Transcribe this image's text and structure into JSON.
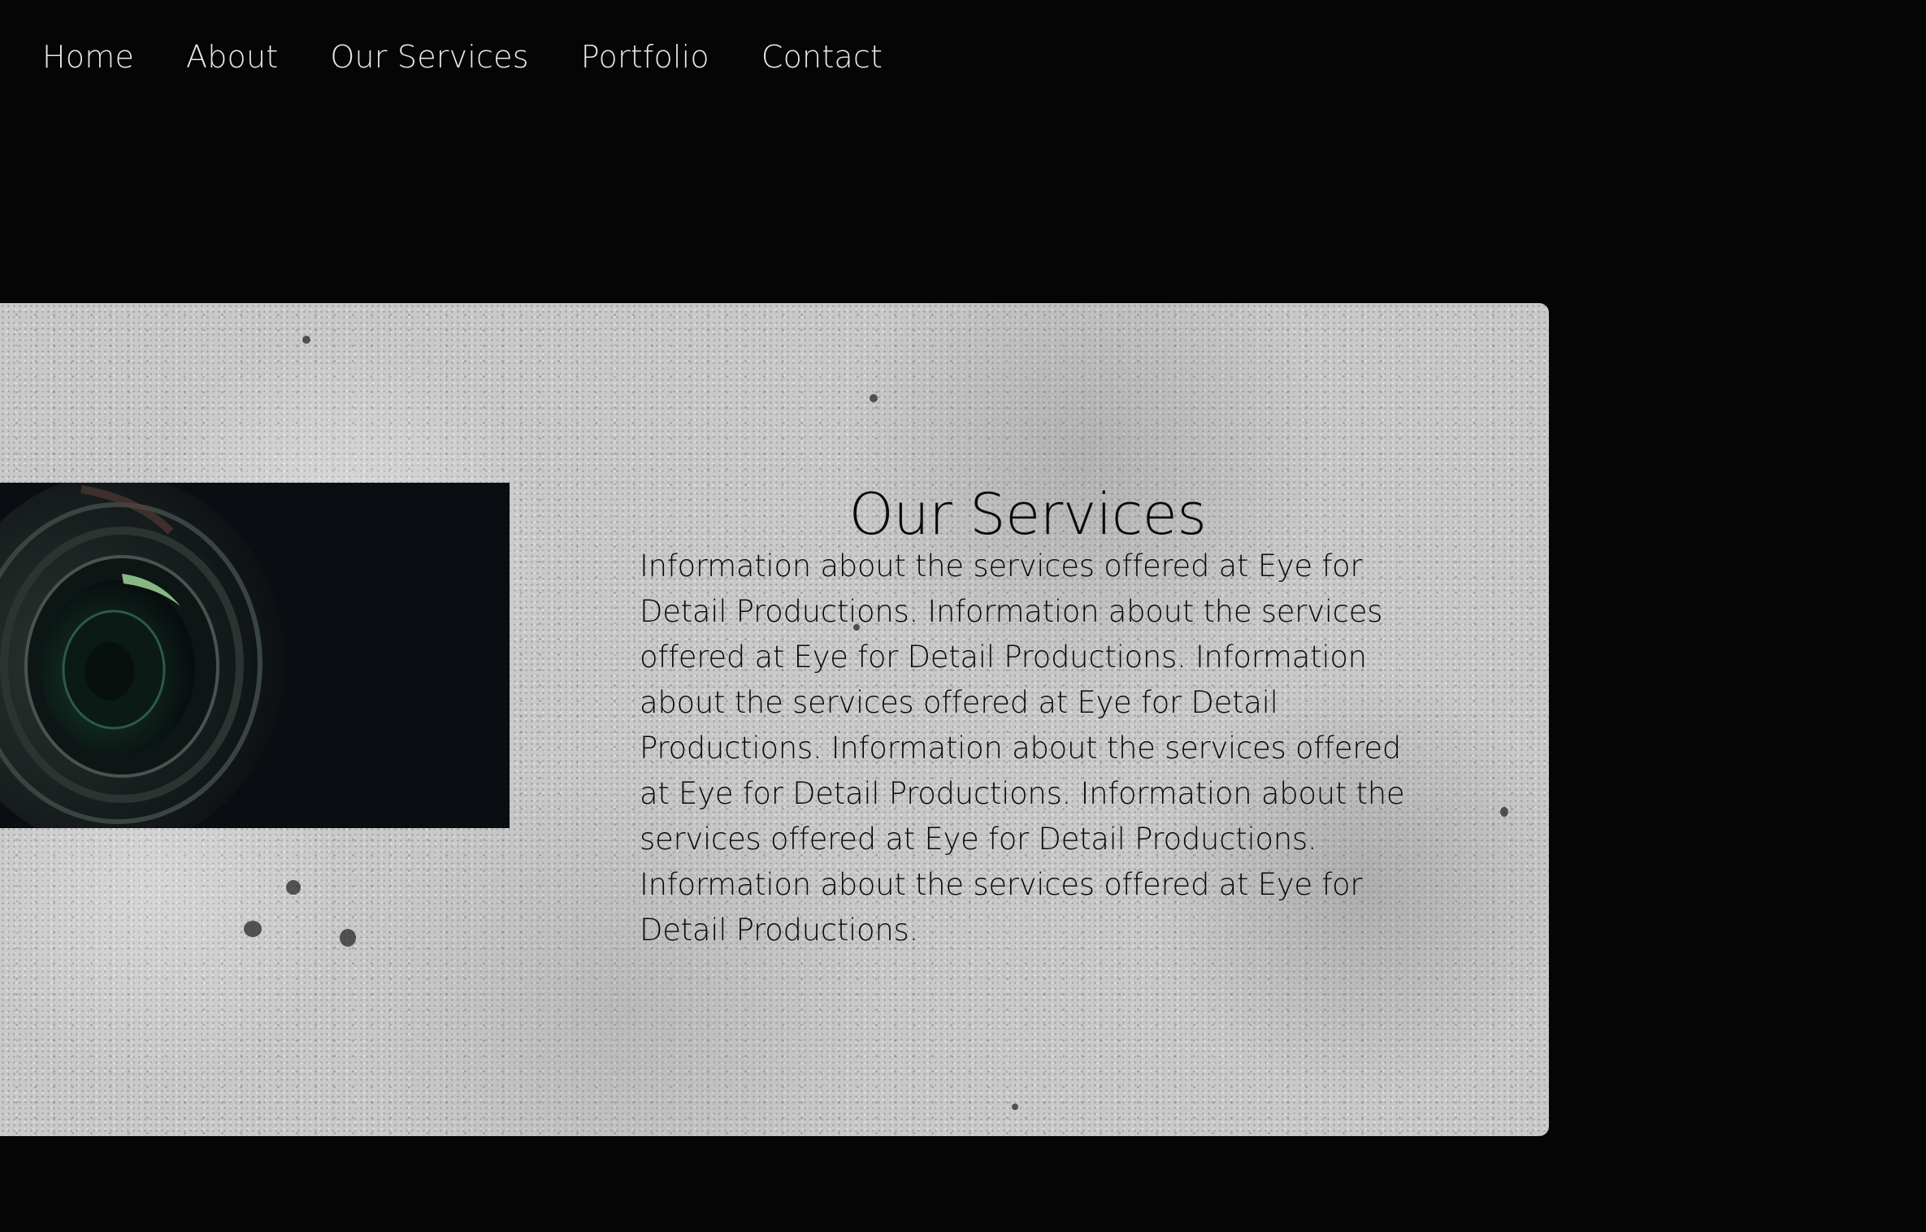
{
  "nav": {
    "items": [
      {
        "label": "Home"
      },
      {
        "label": "About"
      },
      {
        "label": "Our Services"
      },
      {
        "label": "Portfolio"
      },
      {
        "label": "Contact"
      }
    ]
  },
  "services": {
    "title": "Our Services",
    "body": "Information about the services offered at Eye for Detail Productions. Information about the services offered at Eye for Detail Productions. Information about the services offered at Eye for Detail Productions. Information about the services offered at Eye for Detail Productions. Information about the services offered at Eye for Detail Productions. Information about the services offered at Eye for Detail Productions.",
    "image_subject": "camera-lens-photo"
  },
  "colors": {
    "page_background": "#050505",
    "nav_text": "#e9e9e9",
    "panel_concrete": "#c9c9c9",
    "heading_text": "#0a0a0a",
    "lens_background": "#0a0d11",
    "lens_highlight": "#9fd39a"
  }
}
